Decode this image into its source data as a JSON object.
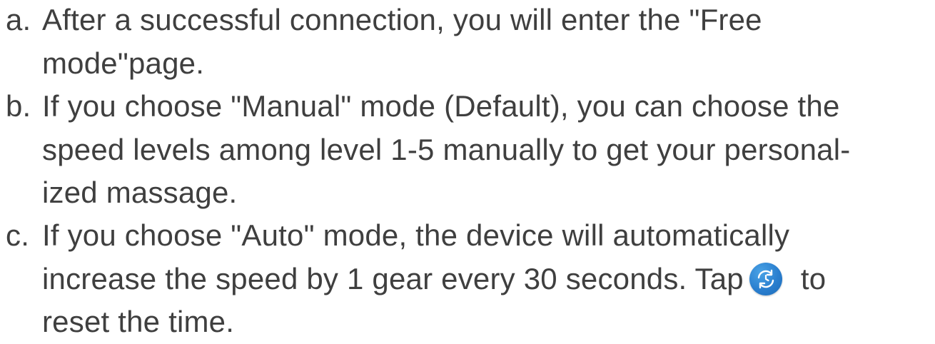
{
  "instructions": {
    "items": [
      {
        "marker": "a.",
        "lines": [
          "After a successful connection, you will enter the \"Free",
          "mode\"page."
        ]
      },
      {
        "marker": "b.",
        "lines": [
          "If you choose \"Manual\" mode (Default), you can choose the",
          "speed levels among level 1-5 manually to get your personal-",
          "ized massage."
        ]
      },
      {
        "marker": "c.",
        "lines": [
          "If you choose \"Auto\" mode, the device will automatically",
          "increase the speed by 1 gear every 30 seconds. Tap",
          "to",
          "reset the time."
        ]
      }
    ],
    "icon": "reset-timer-icon",
    "icon_color": "#2a7fcf",
    "text_color": "#3f3f3f"
  }
}
